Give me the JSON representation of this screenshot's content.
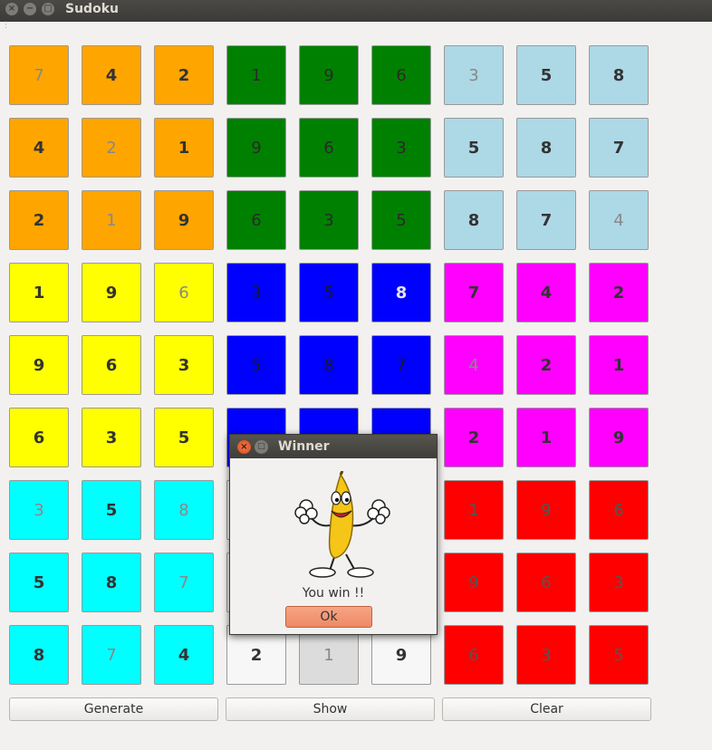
{
  "window": {
    "title": "Sudoku",
    "close_glyph": "×",
    "minimize_glyph": "−",
    "maximize_glyph": "□"
  },
  "grid": [
    [
      {
        "v": "7",
        "c": "#ffa500",
        "hint": true
      },
      {
        "v": "4",
        "c": "#ffa500"
      },
      {
        "v": "2",
        "c": "#ffa500"
      },
      {
        "v": "1",
        "c": "#008000",
        "hint": true
      },
      {
        "v": "9",
        "c": "#008000",
        "hint": true
      },
      {
        "v": "6",
        "c": "#008000",
        "hint": true
      },
      {
        "v": "3",
        "c": "#add8e6",
        "hint": true
      },
      {
        "v": "5",
        "c": "#add8e6"
      },
      {
        "v": "8",
        "c": "#add8e6"
      }
    ],
    [
      {
        "v": "4",
        "c": "#ffa500"
      },
      {
        "v": "2",
        "c": "#ffa500",
        "hint": true
      },
      {
        "v": "1",
        "c": "#ffa500"
      },
      {
        "v": "9",
        "c": "#008000",
        "hint": true
      },
      {
        "v": "6",
        "c": "#008000",
        "hint": true
      },
      {
        "v": "3",
        "c": "#008000",
        "hint": true
      },
      {
        "v": "5",
        "c": "#add8e6"
      },
      {
        "v": "8",
        "c": "#add8e6"
      },
      {
        "v": "7",
        "c": "#add8e6"
      }
    ],
    [
      {
        "v": "2",
        "c": "#ffa500"
      },
      {
        "v": "1",
        "c": "#ffa500",
        "hint": true
      },
      {
        "v": "9",
        "c": "#ffa500"
      },
      {
        "v": "6",
        "c": "#008000",
        "hint": true
      },
      {
        "v": "3",
        "c": "#008000",
        "hint": true
      },
      {
        "v": "5",
        "c": "#008000",
        "hint": true
      },
      {
        "v": "8",
        "c": "#add8e6"
      },
      {
        "v": "7",
        "c": "#add8e6"
      },
      {
        "v": "4",
        "c": "#add8e6",
        "hint": true
      }
    ],
    [
      {
        "v": "1",
        "c": "#ffff00"
      },
      {
        "v": "9",
        "c": "#ffff00"
      },
      {
        "v": "6",
        "c": "#ffff00",
        "hint": true
      },
      {
        "v": "3",
        "c": "#0000ff",
        "hint": true
      },
      {
        "v": "5",
        "c": "#0000ff",
        "hint": true
      },
      {
        "v": "8",
        "c": "#0000ff",
        "light": true
      },
      {
        "v": "7",
        "c": "#ff00ff"
      },
      {
        "v": "4",
        "c": "#ff00ff"
      },
      {
        "v": "2",
        "c": "#ff00ff"
      }
    ],
    [
      {
        "v": "9",
        "c": "#ffff00"
      },
      {
        "v": "6",
        "c": "#ffff00"
      },
      {
        "v": "3",
        "c": "#ffff00"
      },
      {
        "v": "5",
        "c": "#0000ff",
        "hint": true
      },
      {
        "v": "8",
        "c": "#0000ff",
        "hint": true
      },
      {
        "v": "7",
        "c": "#0000ff",
        "hint": true
      },
      {
        "v": "4",
        "c": "#ff00ff",
        "hint": true
      },
      {
        "v": "2",
        "c": "#ff00ff"
      },
      {
        "v": "1",
        "c": "#ff00ff"
      }
    ],
    [
      {
        "v": "6",
        "c": "#ffff00"
      },
      {
        "v": "3",
        "c": "#ffff00"
      },
      {
        "v": "5",
        "c": "#ffff00"
      },
      {
        "v": "",
        "c": "#0000ff"
      },
      {
        "v": "",
        "c": "#0000ff"
      },
      {
        "v": "",
        "c": "#0000ff"
      },
      {
        "v": "2",
        "c": "#ff00ff"
      },
      {
        "v": "1",
        "c": "#ff00ff"
      },
      {
        "v": "9",
        "c": "#ff00ff"
      }
    ],
    [
      {
        "v": "3",
        "c": "#00ffff",
        "hint": true
      },
      {
        "v": "5",
        "c": "#00ffff"
      },
      {
        "v": "8",
        "c": "#00ffff",
        "hint": true
      },
      {
        "v": "",
        "c": "#f7f7f7"
      },
      {
        "v": "",
        "c": "#f7f7f7"
      },
      {
        "v": "",
        "c": "#f7f7f7"
      },
      {
        "v": "1",
        "c": "#ff0000",
        "hint": true
      },
      {
        "v": "9",
        "c": "#ff0000",
        "hint": true
      },
      {
        "v": "6",
        "c": "#ff0000",
        "hint": true
      }
    ],
    [
      {
        "v": "5",
        "c": "#00ffff"
      },
      {
        "v": "8",
        "c": "#00ffff"
      },
      {
        "v": "7",
        "c": "#00ffff",
        "hint": true
      },
      {
        "v": "",
        "c": "#f7f7f7"
      },
      {
        "v": "",
        "c": "#f7f7f7"
      },
      {
        "v": "",
        "c": "#f7f7f7"
      },
      {
        "v": "9",
        "c": "#ff0000",
        "hint": true
      },
      {
        "v": "6",
        "c": "#ff0000",
        "hint": true
      },
      {
        "v": "3",
        "c": "#ff0000",
        "hint": true
      }
    ],
    [
      {
        "v": "8",
        "c": "#00ffff"
      },
      {
        "v": "7",
        "c": "#00ffff",
        "hint": true
      },
      {
        "v": "4",
        "c": "#00ffff"
      },
      {
        "v": "2",
        "c": "#f7f7f7"
      },
      {
        "v": "1",
        "c": "#dcdcdc",
        "hint": true
      },
      {
        "v": "9",
        "c": "#f7f7f7"
      },
      {
        "v": "6",
        "c": "#ff0000",
        "hint": true
      },
      {
        "v": "3",
        "c": "#ff0000",
        "hint": true
      },
      {
        "v": "5",
        "c": "#ff0000",
        "hint": true
      }
    ]
  ],
  "buttons": {
    "generate": "Generate",
    "show": "Show",
    "clear": "Clear"
  },
  "dialog": {
    "title": "Winner",
    "message": "You win !!",
    "ok": "Ok",
    "close_glyph": "×",
    "maximize_glyph": "□",
    "image": "dancing-banana"
  }
}
